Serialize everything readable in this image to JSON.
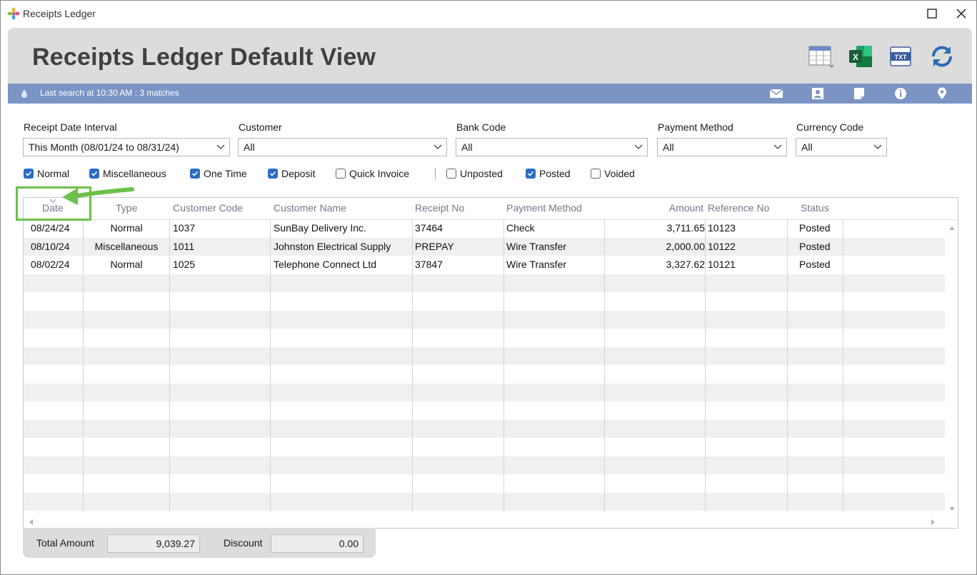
{
  "window": {
    "title": "Receipts Ledger",
    "maximize_glyph": "☐",
    "close_glyph": "✕"
  },
  "header": {
    "title": "Receipts Ledger Default View",
    "tools": [
      "columns-icon",
      "excel-icon",
      "txt-icon",
      "refresh-icon"
    ],
    "excel_label": "X",
    "txt_label": "TXT"
  },
  "status": {
    "text": "Last search at 10:30 AM ; 3 matches",
    "icons": [
      "email-icon",
      "contact-icon",
      "note-icon",
      "info-icon",
      "location-icon"
    ]
  },
  "filters": {
    "date_interval": {
      "label": "Receipt Date Interval",
      "value": "This Month (08/01/24 to 08/31/24)"
    },
    "customer": {
      "label": "Customer",
      "value": "All"
    },
    "bank_code": {
      "label": "Bank Code",
      "value": "All"
    },
    "payment_method": {
      "label": "Payment Method",
      "value": "All"
    },
    "currency_code": {
      "label": "Currency Code",
      "value": "All"
    }
  },
  "checkboxes": [
    {
      "label": "Normal",
      "checked": true
    },
    {
      "label": "Miscellaneous",
      "checked": true
    },
    {
      "label": "One Time",
      "checked": true
    },
    {
      "label": "Deposit",
      "checked": true
    },
    {
      "label": "Quick Invoice",
      "checked": false
    },
    {
      "label": "Unposted",
      "checked": false
    },
    {
      "label": "Posted",
      "checked": true
    },
    {
      "label": "Voided",
      "checked": false
    }
  ],
  "table": {
    "columns": [
      "Date",
      "Type",
      "Customer Code",
      "Customer Name",
      "Receipt No",
      "Payment Method",
      "Amount",
      "Reference No",
      "Status"
    ],
    "rows": [
      [
        "08/24/24",
        "Normal",
        "1037",
        "SunBay Delivery Inc.",
        "37464",
        "Check",
        "3,711.65",
        "10123",
        "Posted"
      ],
      [
        "08/10/24",
        "Miscellaneous",
        "1011",
        "Johnston Electrical Supply",
        "PREPAY",
        "Wire Transfer",
        "2,000.00",
        "10122",
        "Posted"
      ],
      [
        "08/02/24",
        "Normal",
        "1025",
        "Telephone Connect Ltd",
        "37847",
        "Wire Transfer",
        "3,327.62",
        "10121",
        "Posted"
      ]
    ]
  },
  "totals": {
    "total_amount_label": "Total Amount",
    "total_amount": "9,039.27",
    "discount_label": "Discount",
    "discount": "0.00"
  },
  "colors": {
    "accent": "#2b6cc4",
    "status_bar": "#7b94c4",
    "highlight": "#6cc04a",
    "excel_green": "#1e7145"
  }
}
